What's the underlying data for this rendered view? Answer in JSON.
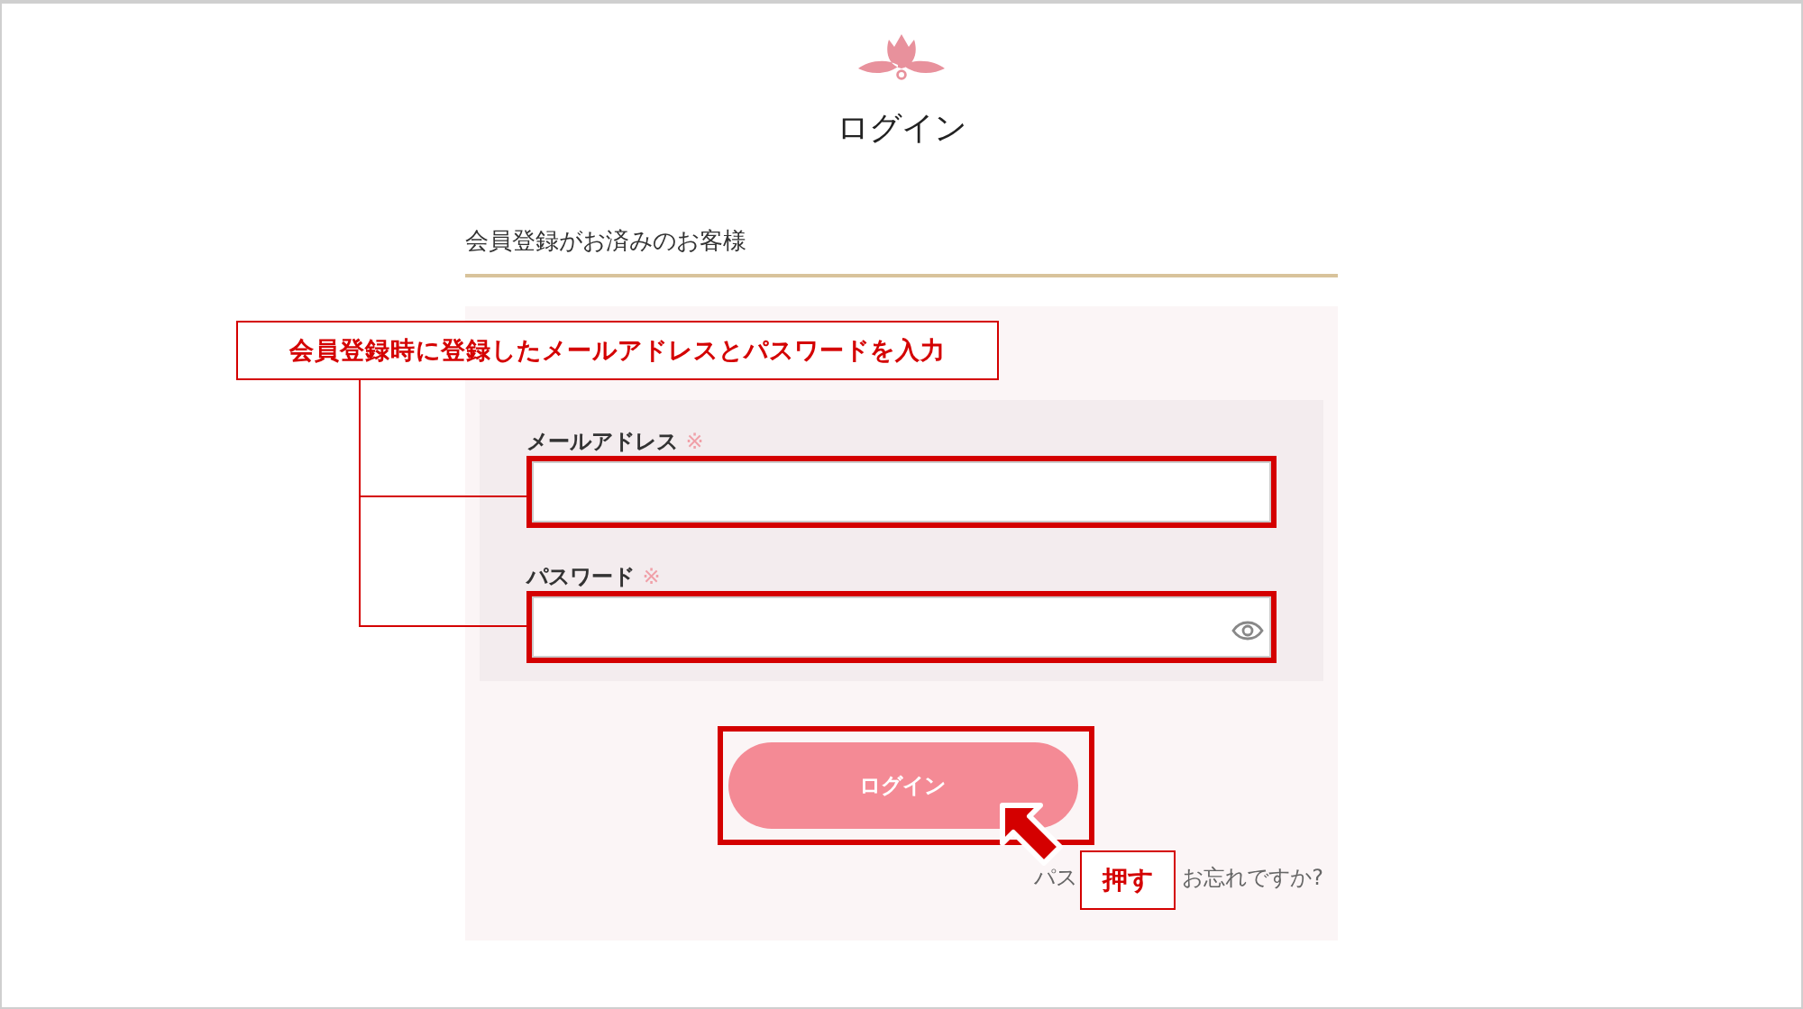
{
  "title": "ログイン",
  "section_heading": "会員登録がお済みのお客様",
  "fields": [
    {
      "kind": "text",
      "label": "メールアドレス",
      "required_mark": "※"
    },
    {
      "kind": "password",
      "label": "パスワード",
      "required_mark": "※"
    }
  ],
  "submit_button": "ログイン",
  "forgot_link": {
    "visible_start": "パス",
    "visible_end": "お忘れですか?"
  },
  "annotations": {
    "callout": "会員登録時に登録したメールアドレスとパスワードを入力",
    "press_badge": "押す"
  }
}
